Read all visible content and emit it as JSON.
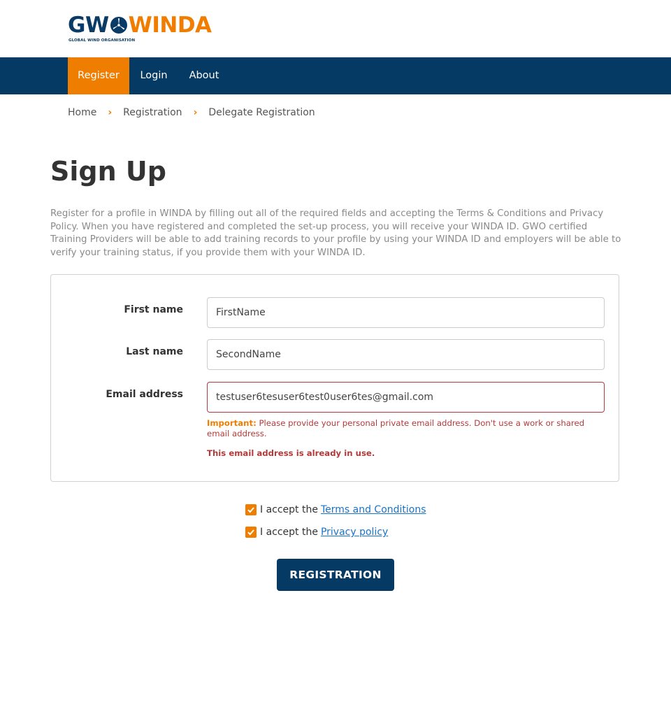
{
  "logo": {
    "left_text": "GW",
    "right_text": "WINDA",
    "subtitle": "GLOBAL WIND ORGANISATION"
  },
  "nav": {
    "items": [
      {
        "label": "Register",
        "active": true
      },
      {
        "label": "Login"
      },
      {
        "label": "About"
      }
    ]
  },
  "breadcrumb": {
    "items": [
      "Home",
      "Registration",
      "Delegate Registration"
    ]
  },
  "page": {
    "title": "Sign Up",
    "intro": "Register for a profile in WINDA by filling out all of the required fields and accepting the Terms & Conditions and Privacy Policy. When you have registered and completed the set-up process, you will receive your WINDA ID. GWO certified Training Providers will be able to add training records to your profile by using your WINDA ID and employers will be able to verify your training status, if you provide them with your WINDA ID."
  },
  "form": {
    "first_name": {
      "label": "First name",
      "value": "FirstName"
    },
    "last_name": {
      "label": "Last name",
      "value": "SecondName"
    },
    "email": {
      "label": "Email address",
      "value": "testuser6tesuser6test0user6tes@gmail.com",
      "help_prefix": "Important:",
      "help_text": " Please provide your personal private email address. Don't use a work or shared email address.",
      "error": "This email address is already in use."
    }
  },
  "consent": {
    "terms_prefix": "I accept the",
    "terms_link": "Terms and Conditions",
    "privacy_prefix": "I accept the",
    "privacy_link": "Privacy policy"
  },
  "submit_label": "REGISTRATION",
  "colors": {
    "brand_navy": "#053a64",
    "brand_orange": "#ef7d00",
    "error_red": "#b33a3a",
    "link_blue": "#1a73c9"
  }
}
